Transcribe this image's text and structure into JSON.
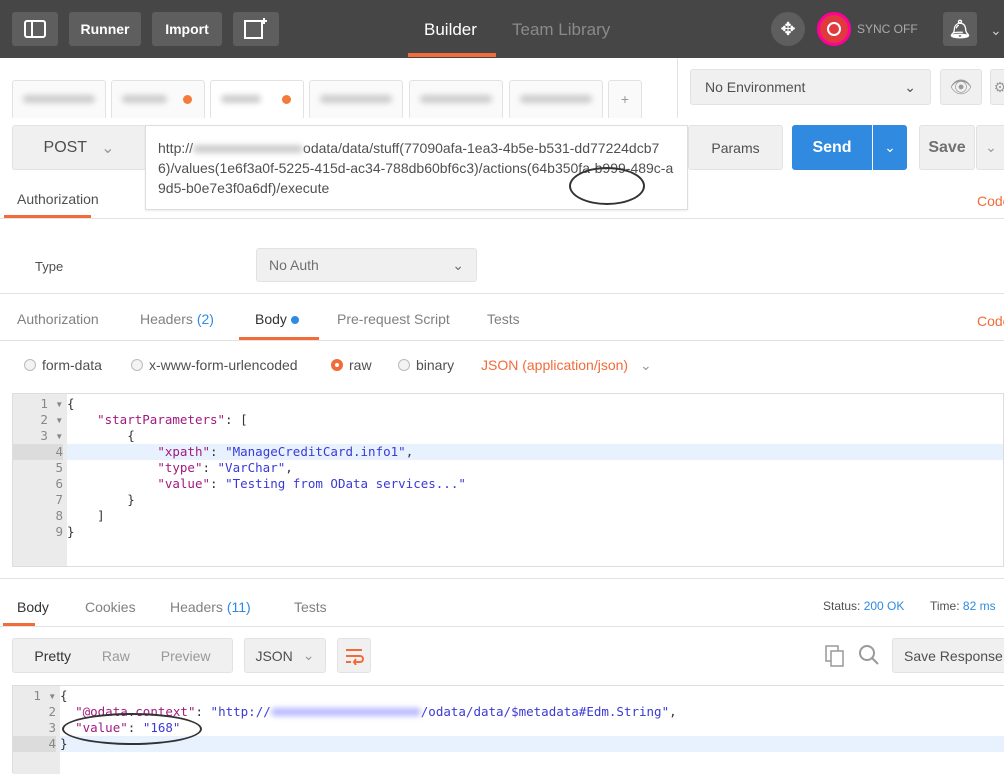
{
  "topbar": {
    "runner": "Runner",
    "import": "Import",
    "tabs": [
      "Builder",
      "Team Library"
    ],
    "sync": "SYNC OFF"
  },
  "request_tabs": {
    "add": "+"
  },
  "environment": {
    "selected": "No Environment"
  },
  "request": {
    "method": "POST",
    "url_prefix": "http://",
    "url_rest": "odata/data/stuff(77090afa-1ea3-4b5e-b531-dd77224dcb76)/values(1e6f3a0f-5225-415d-ac34-788db60bf6c3)/actions(64b350fa-b999-489c-a9d5-b0e7e3f0a6df)/execute",
    "params": "Params",
    "send": "Send",
    "save": "Save"
  },
  "auth_panel": {
    "tab": "Authorization",
    "code": "Code",
    "type_label": "Type",
    "type_value": "No Auth"
  },
  "req_tabs": {
    "authorization": "Authorization",
    "headers": "Headers",
    "headers_count": "(2)",
    "body": "Body",
    "prerequest": "Pre-request Script",
    "tests": "Tests",
    "code": "Code"
  },
  "body_modes": {
    "form_data": "form-data",
    "urlencoded": "x-www-form-urlencoded",
    "raw": "raw",
    "binary": "binary",
    "content_type": "JSON (application/json)"
  },
  "request_body": {
    "lines": [
      [
        {
          "t": "{",
          "c": "punct"
        }
      ],
      [
        {
          "t": "    ",
          "c": "punct"
        },
        {
          "t": "\"startParameters\"",
          "c": "key"
        },
        {
          "t": ": [",
          "c": "punct"
        }
      ],
      [
        {
          "t": "        {",
          "c": "punct"
        }
      ],
      [
        {
          "t": "            ",
          "c": "punct"
        },
        {
          "t": "\"xpath\"",
          "c": "key"
        },
        {
          "t": ": ",
          "c": "punct"
        },
        {
          "t": "\"ManageCreditCard.info1\"",
          "c": "str"
        },
        {
          "t": ",",
          "c": "punct"
        }
      ],
      [
        {
          "t": "            ",
          "c": "punct"
        },
        {
          "t": "\"type\"",
          "c": "key"
        },
        {
          "t": ": ",
          "c": "punct"
        },
        {
          "t": "\"VarChar\"",
          "c": "str"
        },
        {
          "t": ",",
          "c": "punct"
        }
      ],
      [
        {
          "t": "            ",
          "c": "punct"
        },
        {
          "t": "\"value\"",
          "c": "key"
        },
        {
          "t": ": ",
          "c": "punct"
        },
        {
          "t": "\"Testing from OData services...\"",
          "c": "str"
        }
      ],
      [
        {
          "t": "        }",
          "c": "punct"
        }
      ],
      [
        {
          "t": "    ]",
          "c": "punct"
        }
      ],
      [
        {
          "t": "}",
          "c": "punct"
        }
      ]
    ]
  },
  "response": {
    "tabs": {
      "body": "Body",
      "cookies": "Cookies",
      "headers": "Headers",
      "headers_count": "(11)",
      "tests": "Tests"
    },
    "status_label": "Status:",
    "status": "200 OK",
    "time_label": "Time:",
    "time": "82 ms",
    "views": [
      "Pretty",
      "Raw",
      "Preview"
    ],
    "format": "JSON",
    "save_response": "Save Response",
    "lines": [
      [
        {
          "t": "{",
          "c": "punct"
        }
      ],
      [
        {
          "t": "  ",
          "c": "punct"
        },
        {
          "t": "\"@odata.context\"",
          "c": "key"
        },
        {
          "t": ": ",
          "c": "punct"
        },
        {
          "t": "\"http://",
          "c": "str"
        },
        {
          "t": "BLUR",
          "c": "blur"
        },
        {
          "t": "/odata/data/$metadata#Edm.String\"",
          "c": "str"
        },
        {
          "t": ",",
          "c": "punct"
        }
      ],
      [
        {
          "t": "  ",
          "c": "punct"
        },
        {
          "t": "\"value\"",
          "c": "key"
        },
        {
          "t": ": ",
          "c": "punct"
        },
        {
          "t": "\"168\"",
          "c": "str"
        }
      ],
      [
        {
          "t": "}",
          "c": "punct"
        }
      ]
    ]
  },
  "colors": {
    "accent": "#f26b3a",
    "send": "#2f8ae0",
    "topbar": "#464646"
  }
}
